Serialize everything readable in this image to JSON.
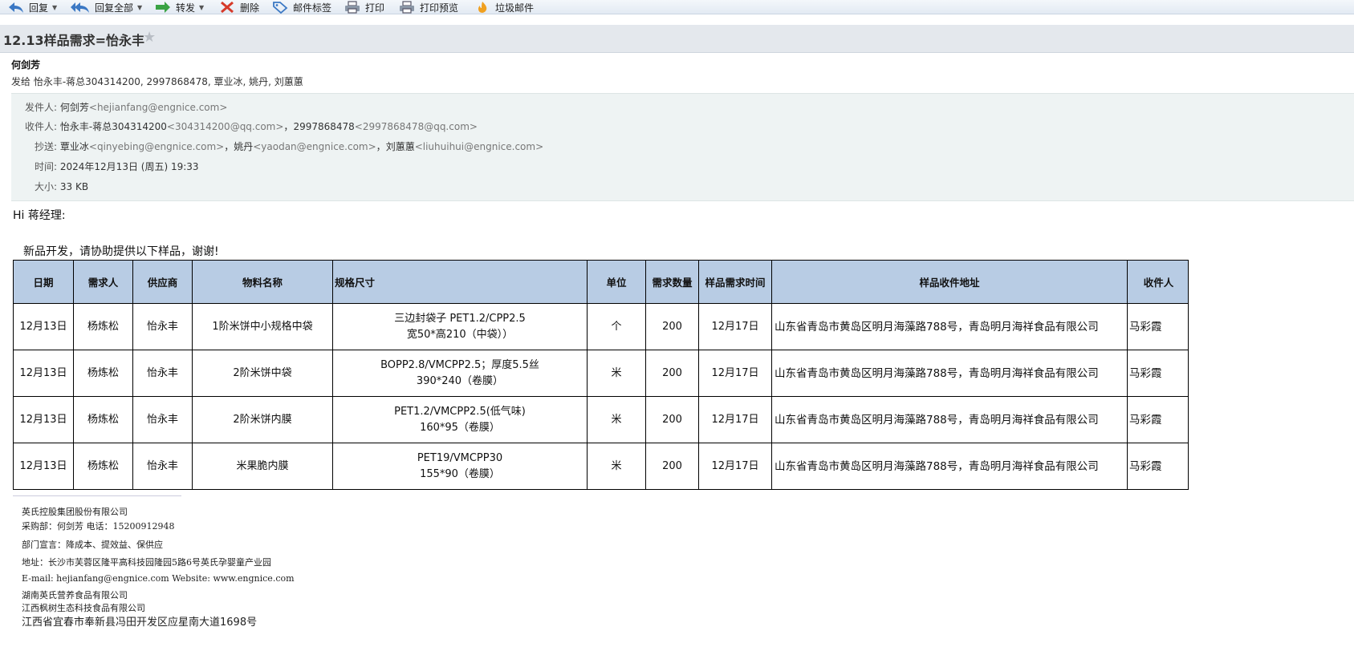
{
  "toolbar": {
    "reply": "回复",
    "reply_all": "回复全部",
    "forward": "转发",
    "delete": "删除",
    "tag": "邮件标签",
    "print": "打印",
    "print_preview": "打印预览",
    "junk": "垃圾邮件"
  },
  "email": {
    "subject": "12.13样品需求=怡永丰",
    "sender_name": "何剑芳",
    "sent_to": "发给 怡永丰-蒋总304314200, 2997868478, 覃业冰, 姚丹, 刘蕙蕙",
    "from_label": "发件人:",
    "from_name": "何剑芳",
    "from_addr": "<hejianfang@engnice.com>",
    "to_label": "收件人:",
    "to_1_name": "怡永丰-蒋总304314200",
    "to_1_addr": "<304314200@qq.com>",
    "sep": "，",
    "to_2_name": "2997868478",
    "to_2_addr": "<2997868478@qq.com>",
    "cc_label": "抄送:",
    "cc_1_name": "覃业冰",
    "cc_1_addr": "<qinyebing@engnice.com>",
    "cc_2_name": "姚丹",
    "cc_2_addr": "<yaodan@engnice.com>",
    "cc_3_name": "刘蕙蕙",
    "cc_3_addr": "<liuhuihui@engnice.com>",
    "time_label": "时间:",
    "time_value": "2024年12月13日 (周五) 19:33",
    "size_label": "大小:",
    "size_value": "33 KB"
  },
  "body": {
    "greeting": "Hi 蒋经理:",
    "intro": "新品开发，请协助提供以下样品，谢谢!"
  },
  "table": {
    "headers": [
      "日期",
      "需求人",
      "供应商",
      "物料名称",
      "规格尺寸",
      "单位",
      "需求数量",
      "样品需求时间",
      "样品收件地址",
      "收件人"
    ],
    "rows": [
      [
        "12月13日",
        "杨炼松",
        "怡永丰",
        "1阶米饼中小规格中袋",
        "三边封袋子 PET1.2/CPP2.5",
        "宽50*高210（中袋））",
        "个",
        "200",
        "12月17日",
        "山东省青岛市黄岛区明月海藻路788号，青岛明月海祥食品有限公司",
        "马彩霞"
      ],
      [
        "12月13日",
        "杨炼松",
        "怡永丰",
        "2阶米饼中袋",
        "BOPP2.8/VMCPP2.5；厚度5.5丝",
        "390*240（卷膜）",
        "米",
        "200",
        "12月17日",
        "山东省青岛市黄岛区明月海藻路788号，青岛明月海祥食品有限公司",
        "马彩霞"
      ],
      [
        "12月13日",
        "杨炼松",
        "怡永丰",
        "2阶米饼内膜",
        "PET1.2/VMCPP2.5(低气味)",
        "160*95（卷膜）",
        "米",
        "200",
        "12月17日",
        "山东省青岛市黄岛区明月海藻路788号，青岛明月海祥食品有限公司",
        "马彩霞"
      ],
      [
        "12月13日",
        "杨炼松",
        "怡永丰",
        "米果脆内膜",
        "PET19/VMCPP30",
        "155*90（卷膜）",
        "米",
        "200",
        "12月17日",
        "山东省青岛市黄岛区明月海藻路788号，青岛明月海祥食品有限公司",
        "马彩霞"
      ]
    ]
  },
  "signature": {
    "company": "英氏控股集团股份有限公司",
    "buyer": "采购部：何剑芳  电话：15200912948",
    "motto": "部门宣言：降成本、提效益、保供应",
    "address": "地址：长沙市芙蓉区隆平高科技园隆园5路6号英氏孕婴童产业园",
    "contact": "E-mail: hejianfang@engnice.com  Website: www.engnice.com",
    "company_2": "湖南英氏营养食品有限公司",
    "company_3": "江西枫树生态科技食品有限公司",
    "address_2": "江西省宜春市奉新县冯田开发区应星南大道1698号"
  },
  "colors": {
    "toolbar_bg": "#e3eaf3",
    "subject_bar_bg": "#e4e8ed",
    "meta_bg": "#eef3f3",
    "table_header_bg": "#b8cce4"
  }
}
